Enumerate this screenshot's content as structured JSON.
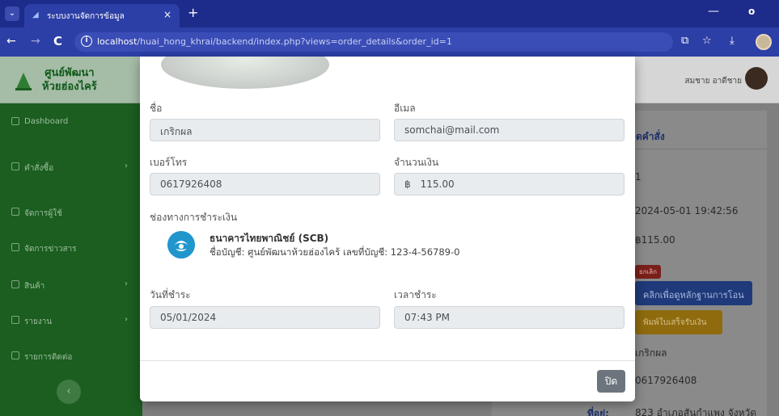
{
  "browser": {
    "tab_title": "ระบบงานจัดการข้อมูล",
    "tab_close": "×",
    "new_tab": "+",
    "url_host": "localhost",
    "url_path": "/huai_hong_khrai/backend/index.php?views=order_details&order_id=1"
  },
  "sidebar": {
    "brand_line1": "ศูนย์พัฒนา",
    "brand_line2": "ห้วยฮ่องไคร้",
    "items": [
      {
        "label": "Dashboard"
      },
      {
        "label": "คำสั่งซื้อ"
      },
      {
        "label": "จัดการผู้ใช้"
      },
      {
        "label": "จัดการข่าวสาร"
      },
      {
        "label": "สินค้า"
      },
      {
        "label": "รายงาน"
      },
      {
        "label": "รายการติดต่อ"
      }
    ],
    "chevron": "›",
    "toggle": "‹"
  },
  "topnav": {
    "user_name": "สมชาย อาดีชาย"
  },
  "background_card": {
    "title": "ดคำสั่ง",
    "order_id_frag": "1",
    "date_frag": "2024-05-01 19:42:56",
    "amount_frag": "฿115.00",
    "status_badge": "ยกเลิก",
    "view_transfer_btn": "คลิกเพื่อดูหลักฐานการโอน",
    "print_receipt_btn": "พิมพ์ใบเสร็จรับเงิน",
    "name_frag": "เกริกผล",
    "phone_frag": "0617926408",
    "address_label": "ที่อยู่:",
    "address_frag": "823 อำเภอสันกำแพง จังหวัด"
  },
  "modal": {
    "name_label": "ชื่อ",
    "name_value": "เกริกผล",
    "email_label": "อีเมล",
    "email_value": "somchai@mail.com",
    "phone_label": "เบอร์โทร",
    "phone_value": "0617926408",
    "amount_label": "จำนวนเงิน",
    "currency_symbol": "฿",
    "amount_value": "115.00",
    "payment_section_label": "ช่องทางการชำระเงิน",
    "bank_name": "ธนาคารไทยพาณิชย์ (SCB)",
    "bank_account": "ชื่อบัญชี: ศูนย์พัฒนาห้วยฮ่องไคร้ เลขที่บัญชี: 123-4-56789-0",
    "pay_date_label": "วันที่ชำระ",
    "pay_date_value": "05/01/2024",
    "pay_time_label": "เวลาชำระ",
    "pay_time_value": "07:43 PM",
    "close_button": "ปิด"
  },
  "colors": {
    "browser_frame": "#1d2b8a",
    "sidebar_green": "#1b5e20",
    "scb_blue": "#2196cc",
    "close_button": "#6c757d"
  }
}
